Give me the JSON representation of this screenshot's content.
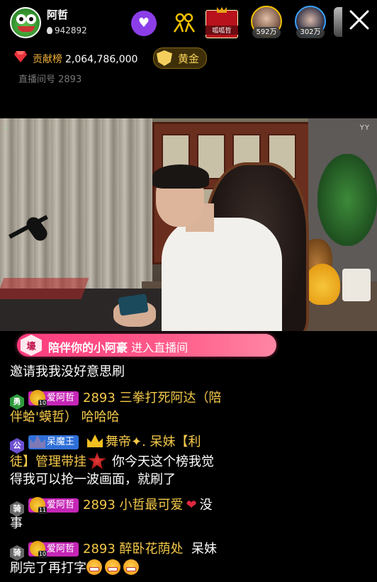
{
  "header": {
    "host_name": "阿哲",
    "host_fans": "942892",
    "heart_glyph": "♥",
    "rank_badge_text": "呱呱哲",
    "viewers": [
      {
        "count": "592万"
      },
      {
        "count": "302万"
      }
    ],
    "close_glyph": "✕"
  },
  "contribution": {
    "label": "贡献榜",
    "value": "2,064,786,000",
    "tier": "黄金",
    "room_label": "直播间号 2893"
  },
  "video": {
    "corner_left": "◦◦",
    "corner_right": "YY"
  },
  "entrance": {
    "tag": "壕",
    "name": "陪伴你的小阿豪",
    "action": "进入直播间"
  },
  "chat": {
    "partial_line": "邀请我我没好意思刷",
    "messages": [
      {
        "level": "勇",
        "fan_badge": "爱阿哲",
        "fan_level": "10",
        "line1": "2893 三拳打死阿达（陪",
        "line2": "伴蛤'蟆哲） 哈哈哈"
      },
      {
        "level": "公",
        "fan_badge": "呆魔王",
        "name": "舞帝✦. 呆妹【利",
        "line2_name": "徒】管理带挂",
        "line2_text": "你今天这个榜我觉",
        "line3": "得我可以抢一波画面，就刷了"
      },
      {
        "level": "骑",
        "fan_badge": "爱阿哲",
        "fan_level": "11",
        "line1": "2893 小哲最可爱",
        "heart": "❤",
        "line1_tail": "没",
        "line2": "事"
      },
      {
        "level": "骑",
        "fan_badge": "爱阿哲",
        "fan_level": "10",
        "line1": "2893 醉卧花荫处",
        "line1_tail": "呆妹",
        "line2": "刷完了再打字"
      }
    ]
  },
  "colors": {
    "accent_pink": "#ff3b7d",
    "username_yellow": "#f5c94a",
    "fan_badge_pink": "#c526b6",
    "heart_button_purple": "#8b3ee8"
  }
}
